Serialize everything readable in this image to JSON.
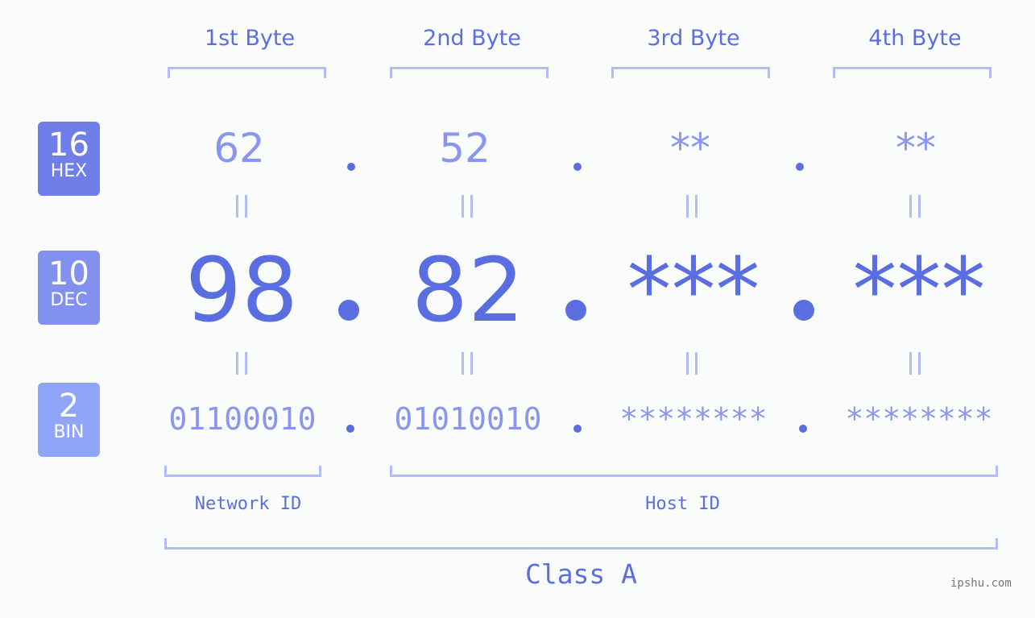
{
  "bytes": [
    {
      "label": "1st Byte",
      "hex": "62",
      "dec": "98",
      "bin": "01100010"
    },
    {
      "label": "2nd Byte",
      "hex": "52",
      "dec": "82",
      "bin": "01010010"
    },
    {
      "label": "3rd Byte",
      "hex": "**",
      "dec": "***",
      "bin": "********"
    },
    {
      "label": "4th Byte",
      "hex": "**",
      "dec": "***",
      "bin": "********"
    }
  ],
  "badges": {
    "hex": {
      "num": "16",
      "label": "HEX",
      "color": "#6f7ee8"
    },
    "dec": {
      "num": "10",
      "label": "DEC",
      "color": "#8291f0"
    },
    "bin": {
      "num": "2",
      "label": "BIN",
      "color": "#8fa5f7"
    }
  },
  "equals_sign": "=",
  "network_id_label": "Network ID",
  "host_id_label": "Host ID",
  "class_label": "Class A",
  "watermark": "ipshu.com"
}
